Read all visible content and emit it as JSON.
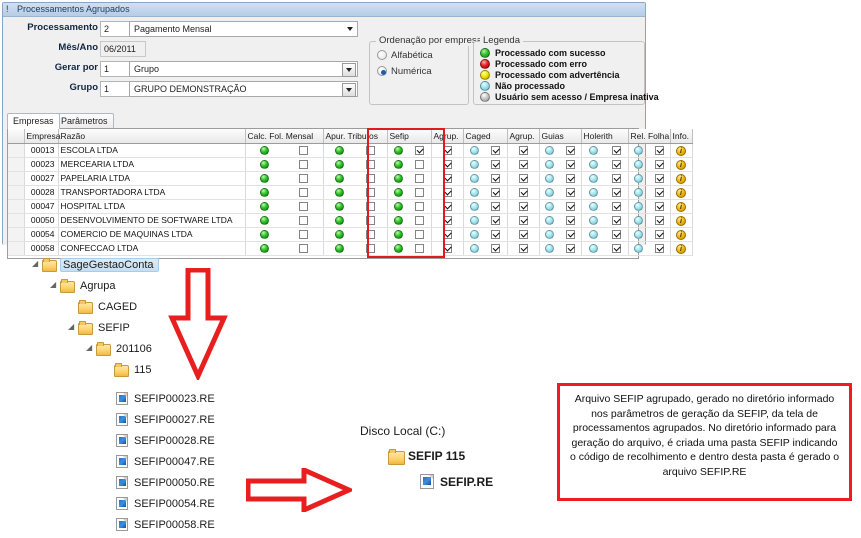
{
  "window": {
    "title": "Processamentos Agrupados"
  },
  "form": {
    "processamento": {
      "label": "Processamento",
      "code": "2",
      "value": "Pagamento Mensal"
    },
    "mes_ano": {
      "label": "Mês/Ano",
      "value": "06/2011"
    },
    "gerar_por": {
      "label": "Gerar por",
      "code": "1",
      "value": "Grupo"
    },
    "grupo": {
      "label": "Grupo",
      "code": "1",
      "value": "GRUPO DEMONSTRAÇÃO"
    }
  },
  "ordenacao": {
    "title": "Ordenação por empresa",
    "options": [
      {
        "label": "Alfabética",
        "selected": false
      },
      {
        "label": "Numérica",
        "selected": true
      }
    ]
  },
  "legenda": {
    "title": "Legenda",
    "items": [
      {
        "color": "green",
        "hex": "#2fc42c",
        "label": "Processado com sucesso"
      },
      {
        "color": "red",
        "hex": "#e02222",
        "label": "Processado com erro"
      },
      {
        "color": "yellow",
        "hex": "#f3e600",
        "label": "Processado com advertência"
      },
      {
        "color": "cyan",
        "hex": "#a6e7f2",
        "label": "Não processado"
      },
      {
        "color": "gray",
        "hex": "#c9c9c9",
        "label": "Usuário sem acesso / Empresa inativa"
      }
    ]
  },
  "tabs": [
    {
      "label": "Empresas",
      "active": true
    },
    {
      "label": "Parâmetros",
      "active": false
    }
  ],
  "grid": {
    "columns": [
      "",
      "Empresa",
      "Razão",
      "Calc. Fol. Mensal",
      "Apur. Tributos",
      "Sefip",
      "Agrup.",
      "Caged",
      "Agrup.",
      "Guias",
      "Holerith",
      "Rel. Folha",
      "Info."
    ],
    "rows": [
      {
        "empresa": "00013",
        "razao": "ESCOLA LTDA",
        "calc_dot": "green",
        "calc_ck": false,
        "apur_dot": "green",
        "apur_ck": false,
        "sefip_dot": "green",
        "sefip_ck": true,
        "sefip_agrup_ck": true,
        "caged_dot": "cyan",
        "caged_ck": true,
        "caged_agrup_ck": true,
        "guias_dot": "cyan",
        "guias_ck": true,
        "holerith_dot": "cyan",
        "holerith_ck": true,
        "relfolha_dot": "cyan",
        "relfolha_ck": true,
        "info": "i"
      },
      {
        "empresa": "00023",
        "razao": "MERCEARIA LTDA",
        "calc_dot": "green",
        "calc_ck": false,
        "apur_dot": "green",
        "apur_ck": false,
        "sefip_dot": "green",
        "sefip_ck": false,
        "sefip_agrup_ck": true,
        "caged_dot": "cyan",
        "caged_ck": true,
        "caged_agrup_ck": true,
        "guias_dot": "cyan",
        "guias_ck": true,
        "holerith_dot": "cyan",
        "holerith_ck": true,
        "relfolha_dot": "cyan",
        "relfolha_ck": true,
        "info": "i"
      },
      {
        "empresa": "00027",
        "razao": "PAPELARIA LTDA",
        "calc_dot": "green",
        "calc_ck": false,
        "apur_dot": "green",
        "apur_ck": false,
        "sefip_dot": "green",
        "sefip_ck": false,
        "sefip_agrup_ck": true,
        "caged_dot": "cyan",
        "caged_ck": true,
        "caged_agrup_ck": true,
        "guias_dot": "cyan",
        "guias_ck": true,
        "holerith_dot": "cyan",
        "holerith_ck": true,
        "relfolha_dot": "cyan",
        "relfolha_ck": true,
        "info": "i"
      },
      {
        "empresa": "00028",
        "razao": "TRANSPORTADORA LTDA",
        "calc_dot": "green",
        "calc_ck": false,
        "apur_dot": "green",
        "apur_ck": false,
        "sefip_dot": "green",
        "sefip_ck": false,
        "sefip_agrup_ck": true,
        "caged_dot": "cyan",
        "caged_ck": true,
        "caged_agrup_ck": true,
        "guias_dot": "cyan",
        "guias_ck": true,
        "holerith_dot": "cyan",
        "holerith_ck": true,
        "relfolha_dot": "cyan",
        "relfolha_ck": true,
        "info": "i"
      },
      {
        "empresa": "00047",
        "razao": "HOSPITAL LTDA",
        "calc_dot": "green",
        "calc_ck": false,
        "apur_dot": "green",
        "apur_ck": false,
        "sefip_dot": "green",
        "sefip_ck": false,
        "sefip_agrup_ck": true,
        "caged_dot": "cyan",
        "caged_ck": true,
        "caged_agrup_ck": true,
        "guias_dot": "cyan",
        "guias_ck": true,
        "holerith_dot": "cyan",
        "holerith_ck": true,
        "relfolha_dot": "cyan",
        "relfolha_ck": true,
        "info": "i"
      },
      {
        "empresa": "00050",
        "razao": "DESENVOLVIMENTO DE SOFTWARE LTDA",
        "calc_dot": "green",
        "calc_ck": false,
        "apur_dot": "green",
        "apur_ck": false,
        "sefip_dot": "green",
        "sefip_ck": false,
        "sefip_agrup_ck": true,
        "caged_dot": "cyan",
        "caged_ck": true,
        "caged_agrup_ck": true,
        "guias_dot": "cyan",
        "guias_ck": true,
        "holerith_dot": "cyan",
        "holerith_ck": true,
        "relfolha_dot": "cyan",
        "relfolha_ck": true,
        "info": "i"
      },
      {
        "empresa": "00054",
        "razao": "COMERCIO DE MAQUINAS LTDA",
        "calc_dot": "green",
        "calc_ck": false,
        "apur_dot": "green",
        "apur_ck": false,
        "sefip_dot": "green",
        "sefip_ck": false,
        "sefip_agrup_ck": true,
        "caged_dot": "cyan",
        "caged_ck": true,
        "caged_agrup_ck": true,
        "guias_dot": "cyan",
        "guias_ck": true,
        "holerith_dot": "cyan",
        "holerith_ck": true,
        "relfolha_dot": "cyan",
        "relfolha_ck": true,
        "info": "i"
      },
      {
        "empresa": "00058",
        "razao": "CONFECCAO LTDA",
        "calc_dot": "green",
        "calc_ck": false,
        "apur_dot": "green",
        "apur_ck": false,
        "sefip_dot": "green",
        "sefip_ck": false,
        "sefip_agrup_ck": true,
        "caged_dot": "cyan",
        "caged_ck": true,
        "caged_agrup_ck": true,
        "guias_dot": "cyan",
        "guias_ck": true,
        "holerith_dot": "cyan",
        "holerith_ck": true,
        "relfolha_dot": "cyan",
        "relfolha_ck": true,
        "info": "i"
      }
    ]
  },
  "tree": {
    "nodes": [
      {
        "label": "SageGestaoConta",
        "depth": 0,
        "expanded": true,
        "selected": true
      },
      {
        "label": "Agrupa",
        "depth": 1,
        "expanded": true,
        "selected": false
      },
      {
        "label": "CAGED",
        "depth": 2,
        "expanded": false,
        "selected": false
      },
      {
        "label": "SEFIP",
        "depth": 2,
        "expanded": true,
        "selected": false
      },
      {
        "label": "201106",
        "depth": 3,
        "expanded": true,
        "selected": false
      },
      {
        "label": "115",
        "depth": 4,
        "expanded": false,
        "selected": false
      }
    ]
  },
  "files": [
    "SEFIP00023.RE",
    "SEFIP00027.RE",
    "SEFIP00028.RE",
    "SEFIP00047.RE",
    "SEFIP00050.RE",
    "SEFIP00054.RE",
    "SEFIP00058.RE"
  ],
  "disco": {
    "title": "Disco Local (C:)",
    "folder": "SEFIP 115",
    "file": "SEFIP.RE"
  },
  "note": {
    "text": "Arquivo SEFIP agrupado, gerado no diretório informado nos parâmetros de geração da SEFIP, da tela de processamentos agrupados. No diretório informado para geração do arquivo, é criada uma pasta SEFIP indicando o código de recolhimento e dentro desta pasta é gerado o arquivo SEFIP.RE",
    "border_color": "#f01b1b"
  },
  "annotations": {
    "highlight_color": "#e01b1b",
    "arrow_down": "arrow-down",
    "arrow_right": "arrow-right"
  }
}
